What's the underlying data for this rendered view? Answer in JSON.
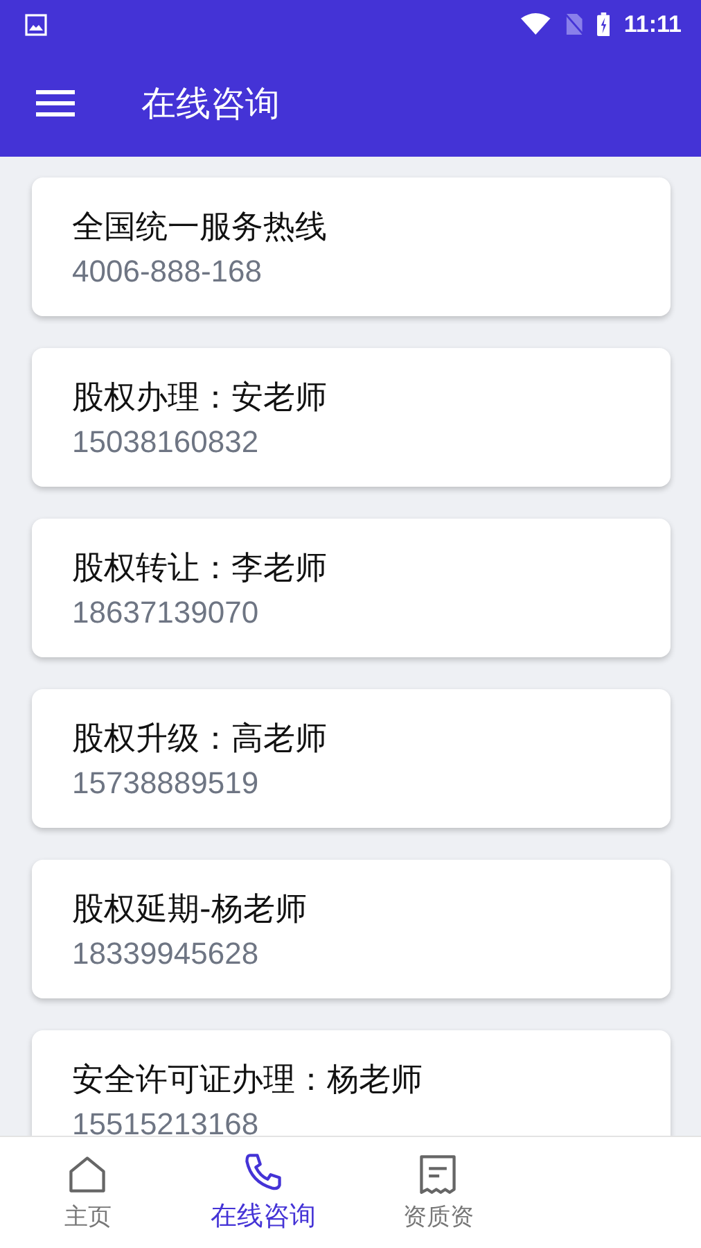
{
  "status_bar": {
    "time": "11:11"
  },
  "app_bar": {
    "title": "在线咨询"
  },
  "contacts": [
    {
      "name": "全国统一服务热线",
      "phone": "4006-888-168"
    },
    {
      "name": "股权办理：安老师",
      "phone": "15038160832"
    },
    {
      "name": "股权转让：李老师",
      "phone": "18637139070"
    },
    {
      "name": "股权升级：高老师",
      "phone": "15738889519"
    },
    {
      "name": "股权延期-杨老师",
      "phone": "18339945628"
    },
    {
      "name": "安全许可证办理：杨老师",
      "phone": "15515213168"
    }
  ],
  "bottom_nav": [
    {
      "label": "主页",
      "kind": "home",
      "selected": false
    },
    {
      "label": "在线咨询",
      "kind": "phone",
      "selected": true
    },
    {
      "label": "资质资",
      "kind": "document",
      "selected": false
    }
  ]
}
